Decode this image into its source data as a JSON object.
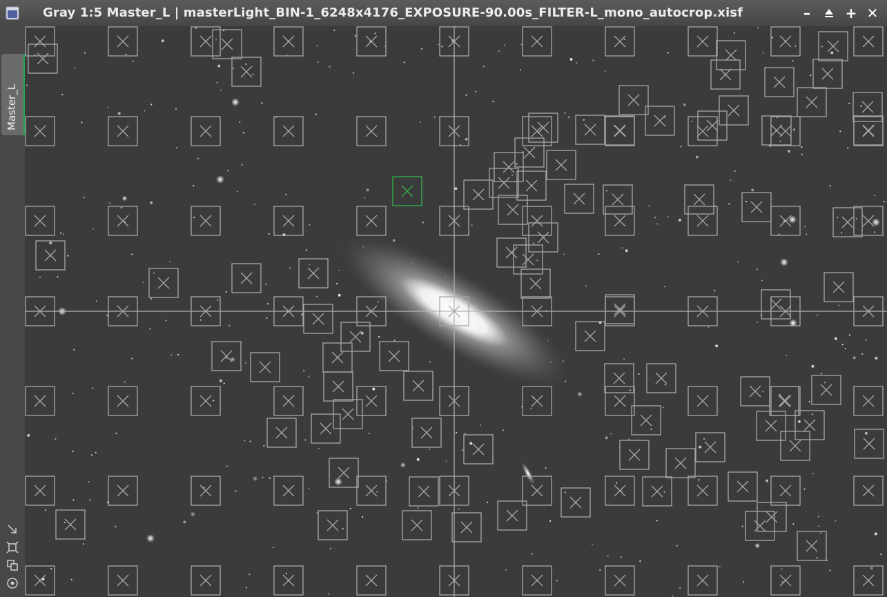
{
  "window": {
    "title": "Gray 1:5 Master_L | masterLight_BIN-1_6248x4176_EXPOSURE-90.00s_FILTER-L_mono_autocrop.xisf",
    "icons": {
      "app": "image-window-icon",
      "minimize": "minimize-icon",
      "shade": "shade-icon",
      "maximize": "maximize-icon",
      "close": "close-icon"
    },
    "controls": {
      "minimize": "–",
      "shade": "▁",
      "maximize": "+",
      "close": "✕"
    }
  },
  "view_tab": {
    "label": "Master_L",
    "accent": "#1fa84f"
  },
  "tools": [
    "resize-arrow-icon",
    "fit-frame-icon",
    "clone-view-icon",
    "target-icon"
  ],
  "image": {
    "background": "#3b3b3b",
    "marker_color": "#a8a8a8",
    "selected_marker_color": "#2fb34a",
    "crosshair_color": "#b5b5b5"
  }
}
